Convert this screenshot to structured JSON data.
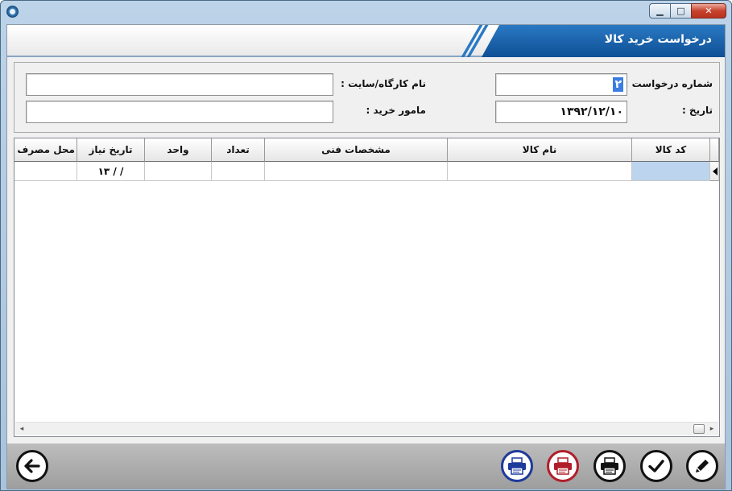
{
  "window": {
    "controls": {
      "minimize": "▁",
      "maximize": "□",
      "close": "✕"
    }
  },
  "form": {
    "title": "درخواست خرید کالا",
    "request_number_label": "شماره درخواست :",
    "request_number_value": "۲",
    "date_label": "تاریخ :",
    "date_value": "۱۳۹۲/۱۲/۱۰",
    "site_name_label": "نام کارگاه/سایت :",
    "site_name_value": "",
    "buyer_label": "مامور خرید :",
    "buyer_value": ""
  },
  "grid": {
    "columns": [
      "کد کالا",
      "نام کالا",
      "مشخصات فنی",
      "تعداد",
      "واحد",
      "تاریخ نیاز",
      "محل مصرف تست"
    ],
    "rows": [
      {
        "kod": "",
        "name": "",
        "specs": "",
        "count": "",
        "unit": "",
        "need_date": "۱۳ / /",
        "usage": ""
      }
    ]
  },
  "toolbar": {
    "buttons": [
      "edit-icon",
      "confirm-icon",
      "print-icon",
      "print-red-icon",
      "print-blue-icon",
      "back-arrow-icon"
    ]
  },
  "colors": {
    "header_blue": "#0e4f94",
    "active_cell": "#bcd4ee",
    "print_red": "#b01e2a",
    "print_blue": "#1e3a9a"
  }
}
